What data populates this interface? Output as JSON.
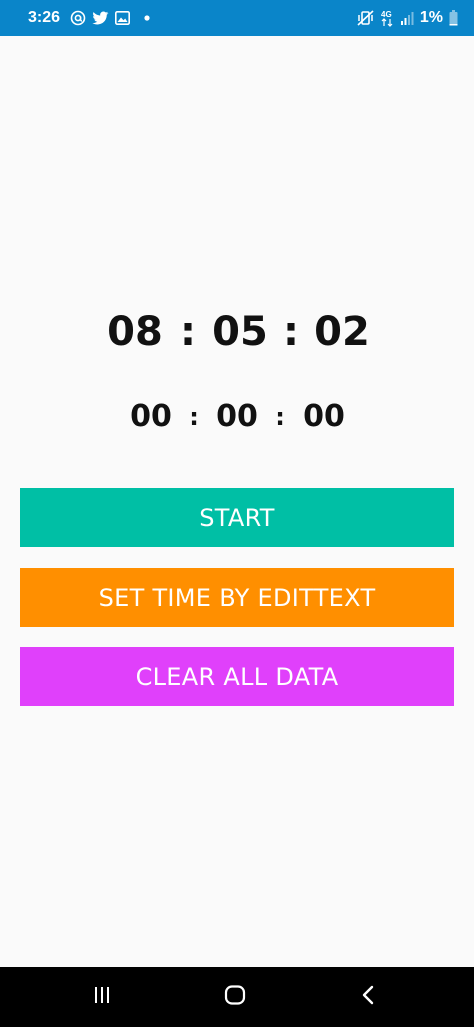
{
  "status_bar": {
    "time": "3:26",
    "battery": "1%",
    "network": "4G",
    "background_color": "#0a85c9",
    "left_icons": [
      "at-sign-icon",
      "twitter-icon",
      "gallery-icon",
      "notification-dot-icon"
    ],
    "right_icons": [
      "mute-vibrate-icon",
      "mobile-data-icon",
      "signal-icon",
      "battery-icon"
    ]
  },
  "timer": {
    "main": {
      "hours": "08",
      "minutes": "05",
      "seconds": "02",
      "separator": ":"
    },
    "secondary": {
      "hours": "00",
      "minutes": "00",
      "seconds": "00",
      "separator": ":"
    }
  },
  "buttons": {
    "start": {
      "label": "START",
      "color": "#00bfa5"
    },
    "set_time": {
      "label": "SET TIME BY EDITTEXT",
      "color": "#ff8f00"
    },
    "clear": {
      "label": "CLEAR ALL DATA",
      "color": "#e040fb"
    }
  },
  "nav_bar": {
    "icons": [
      "recent-apps-icon",
      "home-icon",
      "back-icon"
    ]
  }
}
